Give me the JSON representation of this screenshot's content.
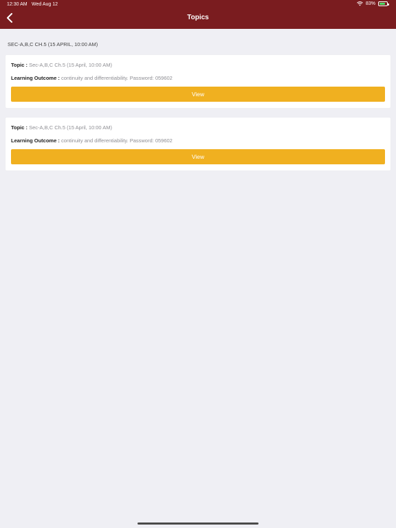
{
  "status_bar": {
    "time": "12:30 AM",
    "date": "Wed Aug 12",
    "battery_pct": "83%",
    "battery_level": 0.83
  },
  "nav": {
    "title": "Topics",
    "back_icon": "chevron-left-icon"
  },
  "section_header": "SEC-A,B,C CH.5 (15 APRIL, 10:00 AM)",
  "cards": [
    {
      "topic_label": "Topic :",
      "topic_value": "Sec-A,B,C Ch.5 (15 April, 10:00 AM)",
      "outcome_label": "Learning Outcome :",
      "outcome_value": "continuity and differentiability. Password: 059602",
      "button_label": "View"
    },
    {
      "topic_label": "Topic :",
      "topic_value": "Sec-A,B,C Ch.5 (15 April, 10:00 AM)",
      "outcome_label": "Learning Outcome :",
      "outcome_value": "continuity and differentiability. Password: 059602",
      "button_label": "View"
    }
  ],
  "colors": {
    "header_bg": "#7a1c1f",
    "accent_button": "#f0b020",
    "page_bg": "#efeff4"
  }
}
